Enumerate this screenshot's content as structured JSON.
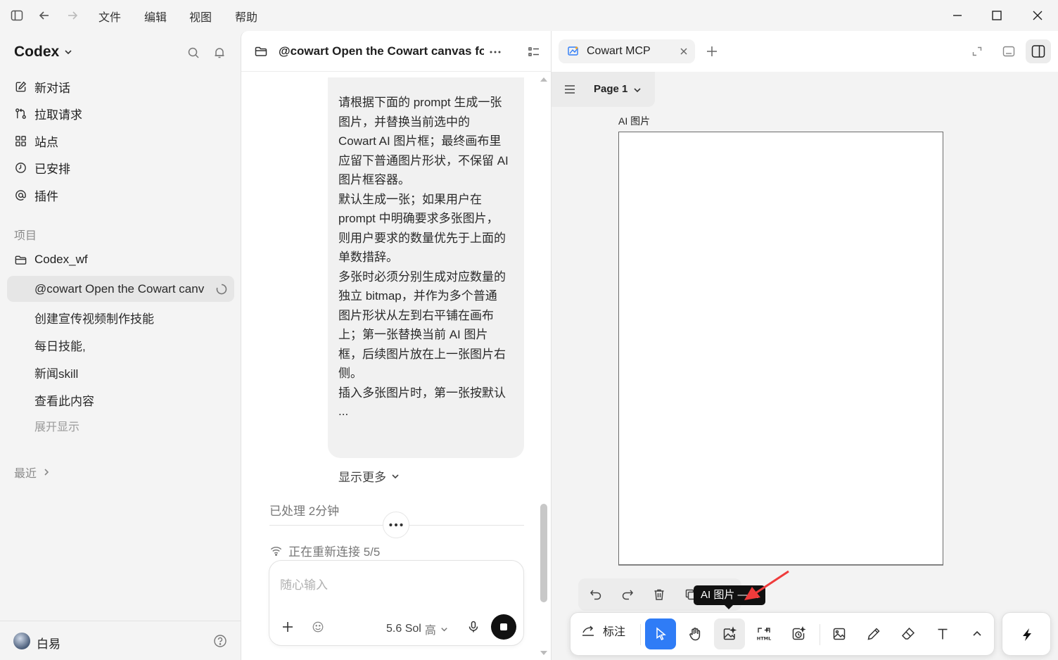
{
  "menu": {
    "file": "文件",
    "edit": "编辑",
    "view": "视图",
    "help": "帮助"
  },
  "sidebar": {
    "brand": "Codex",
    "nav": [
      {
        "label": "新对话",
        "icon": "edit-icon"
      },
      {
        "label": "拉取请求",
        "icon": "pull-request-icon"
      },
      {
        "label": "站点",
        "icon": "grid-icon"
      },
      {
        "label": "已安排",
        "icon": "clock-icon"
      },
      {
        "label": "插件",
        "icon": "at-icon"
      }
    ],
    "projects_label": "项目",
    "project_name": "Codex_wf",
    "threads": [
      "@cowart Open the Cowart canv",
      "创建宣传视频制作技能",
      "每日技能,",
      "新闻skill",
      "查看此内容"
    ],
    "show_more": "展开显示",
    "recent_label": "最近",
    "user_name": "白易"
  },
  "chat": {
    "title": "@cowart Open the Cowart canvas fo",
    "message_lines": [
      "请根据下面的 prompt 生成一张",
      "图片，并替换当前选中的",
      "Cowart AI 图片框；最终画布里",
      "应留下普通图片形状，不保留 AI",
      "图片框容器。",
      "默认生成一张；如果用户在",
      "prompt 中明确要求多张图片，",
      "则用户要求的数量优先于上面的",
      "单数措辞。",
      "多张时必须分别生成对应数量的",
      "独立 bitmap，并作为多个普通",
      "图片形状从左到右平铺在画布",
      "上；第一张替换当前 AI 图片",
      "框，后续图片放在上一张图片右",
      "侧。",
      "插入多张图片时，第一张按默认",
      "..."
    ],
    "show_more": "显示更多",
    "processed": "已处理 2分钟",
    "reconnecting": "正在重新连接 5/5",
    "composer_placeholder": "随心输入",
    "model": "5.6 Sol",
    "effort": "高"
  },
  "panel": {
    "tab_title": "Cowart MCP",
    "page": "Page 1",
    "frame_label": "AI 图片",
    "tooltip": "AI 图片 — A",
    "annotate_label": "标注"
  },
  "colors": {
    "accent": "#2f7cf6",
    "arrow": "#ef3b3b"
  }
}
